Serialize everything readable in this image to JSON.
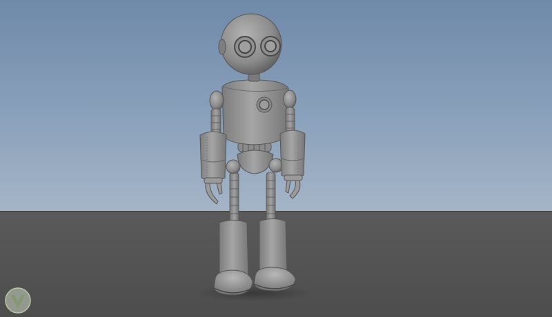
{
  "scene": {
    "subject_icon": "robot-character-model",
    "watermark_icon": "v-shield-logo",
    "colors": {
      "sky_top": "#6f89a9",
      "sky_bottom": "#a5b5c7",
      "floor": "#545454",
      "model_gray": "#8e8e8e",
      "model_dark": "#5c5c5c",
      "model_light": "#b0b0b0"
    }
  }
}
